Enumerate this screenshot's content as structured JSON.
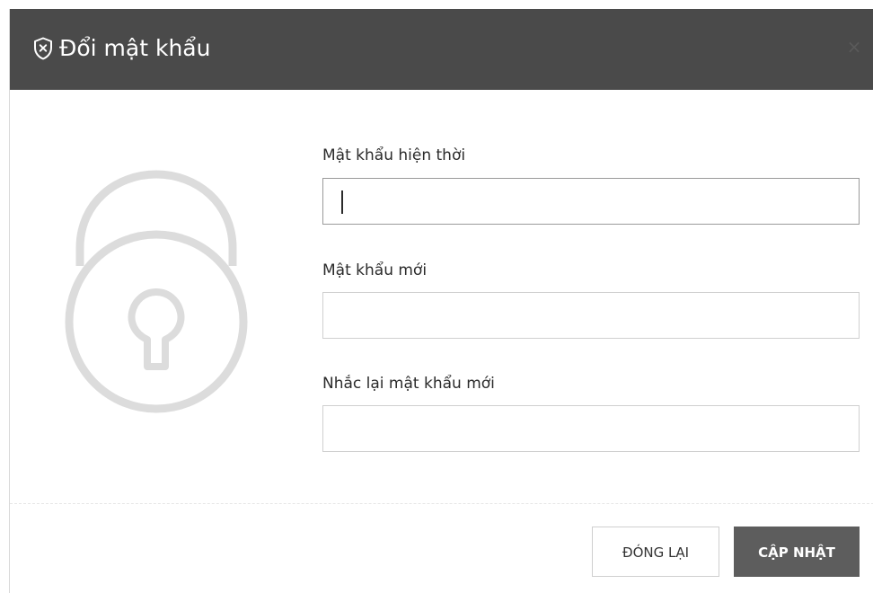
{
  "dialog": {
    "title": "Đổi mật khẩu",
    "header_icon": "shield-x-icon",
    "close_icon": "close-icon",
    "close_symbol": "×",
    "illustration_icon": "padlock-icon"
  },
  "form": {
    "current_password": {
      "label": "Mật khẩu hiện thời",
      "value": "",
      "focused": true
    },
    "new_password": {
      "label": "Mật khẩu mới",
      "value": ""
    },
    "confirm_password": {
      "label": "Nhắc lại mật khẩu mới",
      "value": ""
    }
  },
  "footer": {
    "close_label": "ĐÓNG LẠI",
    "update_label": "CẬP NHẬT"
  },
  "colors": {
    "header_bg": "#4a4a4a",
    "primary_button": "#5d5d5d",
    "illustration": "#dcdcdc"
  }
}
